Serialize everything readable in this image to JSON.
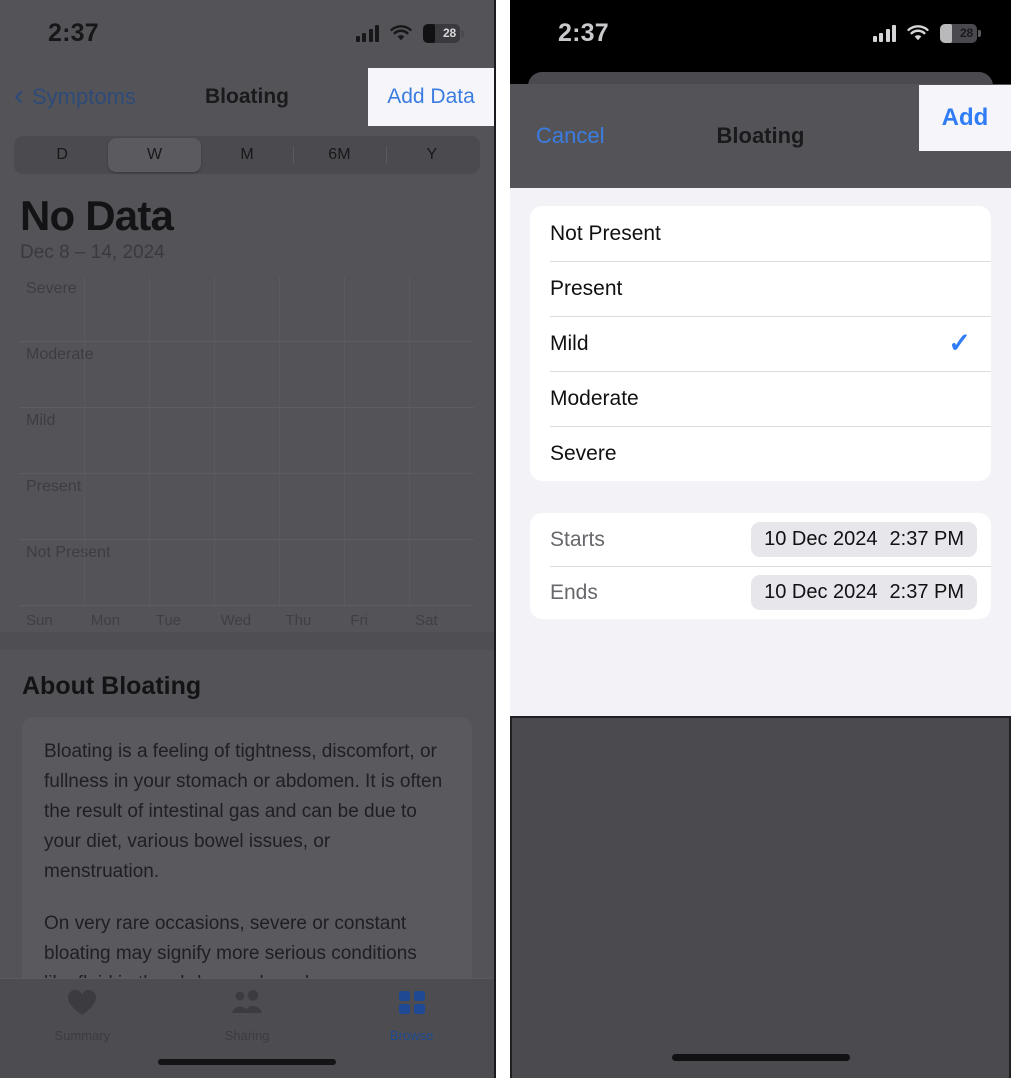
{
  "left_screen": {
    "status_bar": {
      "time": "2:37",
      "battery_level": "28",
      "icons": [
        "cellular-signal-icon",
        "wifi-icon",
        "battery-icon"
      ]
    },
    "nav": {
      "back_label": "Symptoms",
      "title": "Bloating",
      "action_label": "Add Data"
    },
    "segmented_control": {
      "options": [
        "D",
        "W",
        "M",
        "6M",
        "Y"
      ],
      "selected": "W"
    },
    "chart_header": {
      "value": "No Data",
      "date_range": "Dec 8 – 14, 2024"
    },
    "about": {
      "title": "About Bloating",
      "paragraphs": [
        "Bloating is a feeling of tightness, discomfort, or fullness in your stomach or abdomen. It is often the result of intestinal gas and can be due to your diet, various bowel issues, or menstruation.",
        "On very rare occasions, severe or constant bloating may signify more serious conditions like fluid in the abdomen, bowel"
      ]
    },
    "tab_bar": {
      "tabs": [
        {
          "label": "Summary",
          "icon": "heart-icon",
          "active": false
        },
        {
          "label": "Sharing",
          "icon": "people-icon",
          "active": false
        },
        {
          "label": "Browse",
          "icon": "grid-icon",
          "active": true
        }
      ]
    }
  },
  "chart_data": {
    "type": "bar",
    "title": "No Data",
    "subtitle": "Dec 8 – 14, 2024",
    "categories": [
      "Sun",
      "Mon",
      "Tue",
      "Wed",
      "Thu",
      "Fri",
      "Sat"
    ],
    "values": [
      null,
      null,
      null,
      null,
      null,
      null,
      null
    ],
    "ylabel": "",
    "xlabel": "",
    "y_tick_labels": [
      "Severe",
      "Moderate",
      "Mild",
      "Present",
      "Not Present"
    ],
    "grid": true,
    "legend": "none",
    "state": "no-data"
  },
  "right_screen": {
    "status_bar": {
      "time": "2:37",
      "battery_level": "28"
    },
    "sheet_nav": {
      "cancel_label": "Cancel",
      "title": "Bloating",
      "add_label": "Add"
    },
    "severity_options": [
      {
        "label": "Not Present",
        "selected": false
      },
      {
        "label": "Present",
        "selected": false
      },
      {
        "label": "Mild",
        "selected": true
      },
      {
        "label": "Moderate",
        "selected": false
      },
      {
        "label": "Severe",
        "selected": false
      }
    ],
    "checkmark_glyph": "✓",
    "date_rows": [
      {
        "label": "Starts",
        "date": "10 Dec 2024",
        "time": "2:37 PM"
      },
      {
        "label": "Ends",
        "date": "10 Dec 2024",
        "time": "2:37 PM"
      }
    ]
  },
  "colors": {
    "accent_blue": "#2f7cf6",
    "nav_blue": "#3b7ce0",
    "dim_backdrop": "#545458",
    "sheet_bg": "#f2f2f7",
    "card_white": "#ffffff",
    "browse_active": "#1f4a93"
  }
}
